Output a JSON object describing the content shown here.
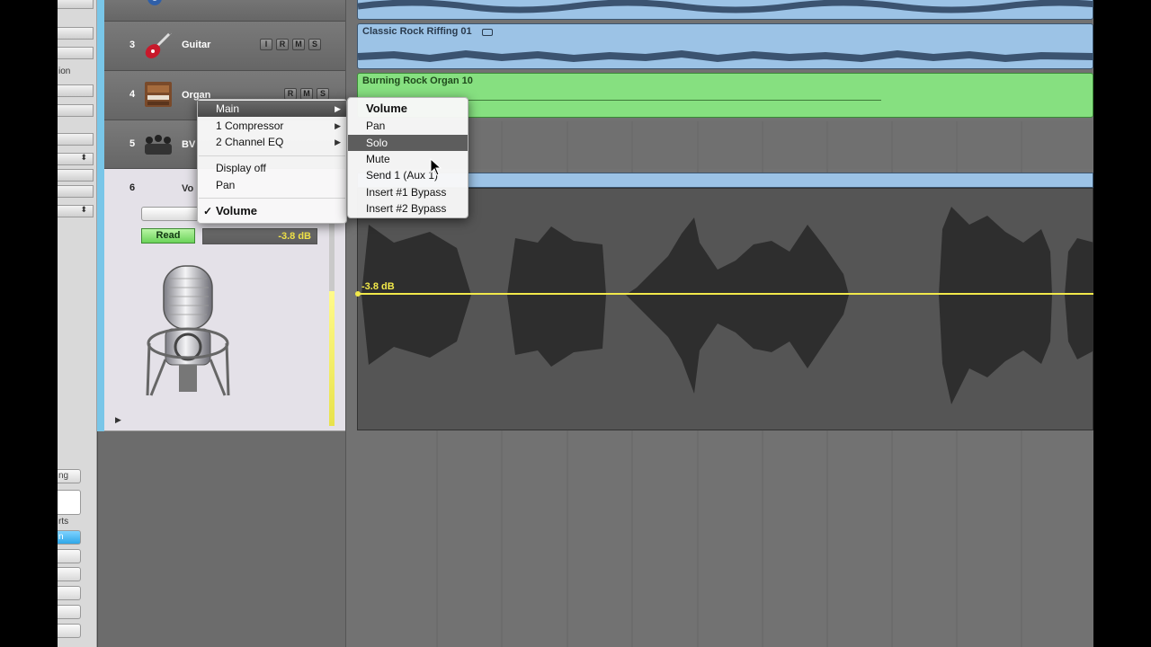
{
  "inspector": {
    "text_lines": [
      "ion",
      "ng",
      "rts"
    ],
    "buttons": [
      "ng",
      "n"
    ],
    "steppers": [
      "⬍",
      "⬍",
      "⬍"
    ]
  },
  "tracks": [
    {
      "number": "3",
      "name": "Guitar",
      "icon": "electric-guitar-icon",
      "buttons": [
        "I",
        "R",
        "M",
        "S"
      ]
    },
    {
      "number": "4",
      "name": "Organ",
      "icon": "organ-icon",
      "buttons": [
        "R",
        "M",
        "S"
      ]
    },
    {
      "number": "5",
      "name": "BV",
      "icon": "choir-icon"
    },
    {
      "number": "6",
      "name": "Vo",
      "icon": "microphone-icon",
      "automation_mode": "Read",
      "automation_value": "-3.8 dB"
    }
  ],
  "regions": [
    {
      "title": "Classic Rock Riffing 01",
      "color": "#9cc3e6"
    },
    {
      "title": "Burning Rock Organ 10",
      "color": "#86e080"
    }
  ],
  "automation": {
    "line_label": "-3.8 dB",
    "line_color": "#f2e94a"
  },
  "context_menu": {
    "items": [
      "Main",
      "1 Compressor",
      "2 Channel EQ"
    ],
    "items2": [
      "Display off",
      "Pan"
    ],
    "checked_item": "Volume",
    "check": "✓",
    "arrow": "▶"
  },
  "submenu": {
    "items": [
      "Volume",
      "Pan",
      "Solo",
      "Mute",
      "Send 1 (Aux 1)",
      "Insert #1 Bypass",
      "Insert #2 Bypass"
    ],
    "selected": "Solo"
  },
  "disclosure_glyph": "▶"
}
